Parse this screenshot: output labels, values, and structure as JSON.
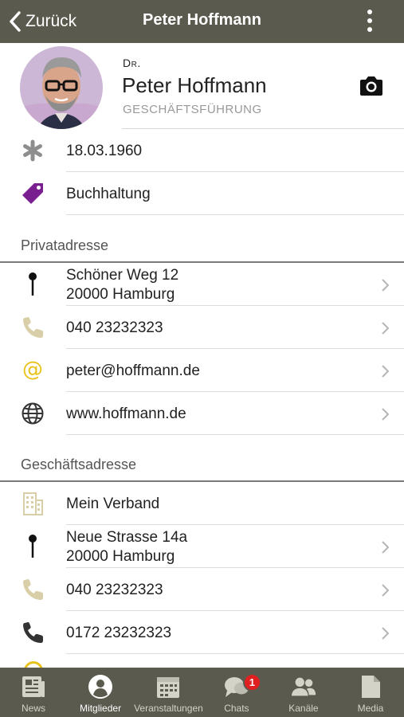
{
  "header": {
    "back_label": "Zurück",
    "title": "Peter Hoffmann"
  },
  "profile": {
    "prefix": "Dr.",
    "name": "Peter Hoffmann",
    "role": "GESCHÄFTSFÜHRUNG"
  },
  "info": [
    {
      "icon": "asterisk-icon",
      "text": "18.03.1960"
    },
    {
      "icon": "tag-icon",
      "text": "Buchhaltung"
    }
  ],
  "private": {
    "title": "Privatadresse",
    "address_line1": "Schöner Weg 12",
    "address_line2": "20000 Hamburg",
    "phone": "040 23232323",
    "email": "peter@hoffmann.de",
    "web": "www.hoffmann.de"
  },
  "business": {
    "title": "Geschäftsadresse",
    "company": "Mein Verband",
    "address_line1": "Neue Strasse 14a",
    "address_line2": "20000 Hamburg",
    "phone": "040 23232323",
    "mobile": "0172 23232323"
  },
  "tabs": [
    {
      "label": "News",
      "icon": "news-icon",
      "active": false
    },
    {
      "label": "Mitglieder",
      "icon": "members-icon",
      "active": true
    },
    {
      "label": "Veranstaltungen",
      "icon": "calendar-icon",
      "active": false
    },
    {
      "label": "Chats",
      "icon": "chat-icon",
      "active": false,
      "badge": "1"
    },
    {
      "label": "Kanäle",
      "icon": "channels-icon",
      "active": false
    },
    {
      "label": "Media",
      "icon": "media-icon",
      "active": false
    }
  ],
  "colors": {
    "bar": "#5b5a4e",
    "tag": "#7a1f8f",
    "email": "#e8c21a",
    "phone_light": "#d8cfa8",
    "badge": "#e02020"
  }
}
